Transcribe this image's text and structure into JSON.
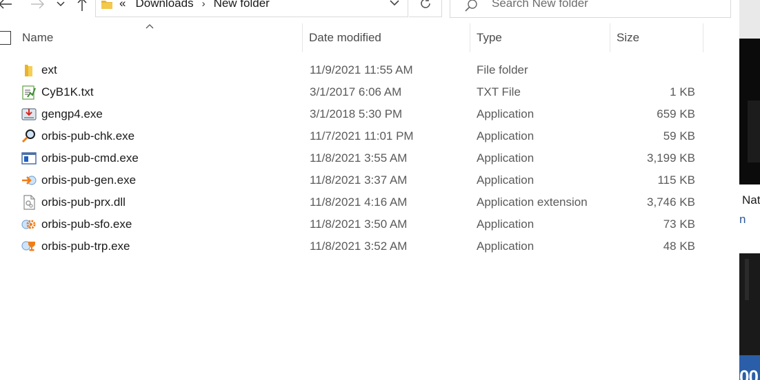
{
  "address": {
    "overflow": "«",
    "crumbs": [
      "Downloads",
      "New folder"
    ]
  },
  "search": {
    "placeholder": "Search New folder"
  },
  "columns": {
    "name": "Name",
    "date": "Date modified",
    "type": "Type",
    "size": "Size"
  },
  "files": [
    {
      "icon": "folder-icon",
      "name": "ext",
      "date": "11/9/2021 11:55 AM",
      "type": "File folder",
      "size": ""
    },
    {
      "icon": "text-file-icon",
      "name": "CyB1K.txt",
      "date": "3/1/2017 6:06 AM",
      "type": "TXT File",
      "size": "1 KB"
    },
    {
      "icon": "installer-icon",
      "name": "gengp4.exe",
      "date": "3/1/2018 5:30 PM",
      "type": "Application",
      "size": "659 KB"
    },
    {
      "icon": "magnifier-app-icon",
      "name": "orbis-pub-chk.exe",
      "date": "11/7/2021 11:01 PM",
      "type": "Application",
      "size": "59 KB"
    },
    {
      "icon": "window-app-icon",
      "name": "orbis-pub-cmd.exe",
      "date": "11/8/2021 3:55 AM",
      "type": "Application",
      "size": "3,199 KB"
    },
    {
      "icon": "arrow-app-icon",
      "name": "orbis-pub-gen.exe",
      "date": "11/8/2021 3:37 AM",
      "type": "Application",
      "size": "115 KB"
    },
    {
      "icon": "dll-file-icon",
      "name": "orbis-pub-prx.dll",
      "date": "11/8/2021 4:16 AM",
      "type": "Application extension",
      "size": "3,746 KB"
    },
    {
      "icon": "gear-app-icon",
      "name": "orbis-pub-sfo.exe",
      "date": "11/8/2021 3:50 AM",
      "type": "Application",
      "size": "73 KB"
    },
    {
      "icon": "trophy-app-icon",
      "name": "orbis-pub-trp.exe",
      "date": "11/8/2021 3:52 AM",
      "type": "Application",
      "size": "48 KB"
    }
  ],
  "background": {
    "text1": "Nat",
    "text2": "n",
    "text3": "00"
  },
  "colors": {
    "folder": "#e8b431",
    "accent": "#0063b1",
    "orange": "#f07d19"
  }
}
